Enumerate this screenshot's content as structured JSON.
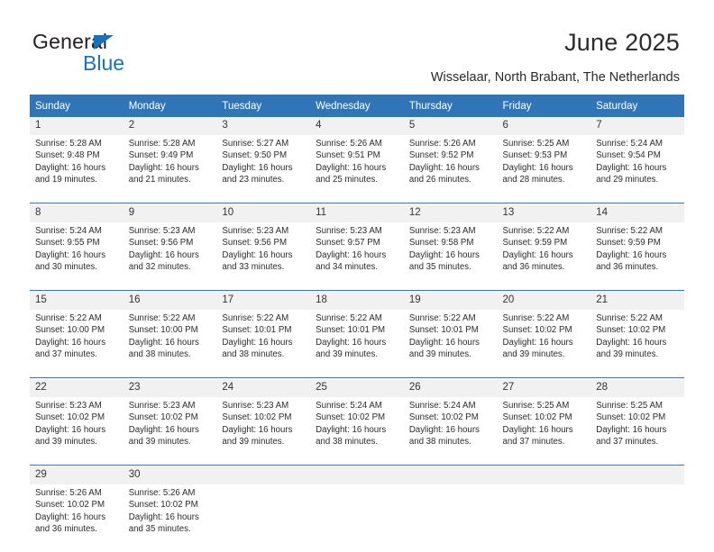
{
  "brand": {
    "name_top": "General",
    "name_bottom": "Blue",
    "triangle_icon": "triangle-icon",
    "accent_color": "#1a72b8"
  },
  "header": {
    "title": "June 2025",
    "subtitle": "Wisselaar, North Brabant, The Netherlands"
  },
  "theme": {
    "header_blue": "#3075b8",
    "daynum_background": "#f1f1f1",
    "text_color": "#2b2b2b"
  },
  "calendar": {
    "weekday_headers": [
      "Sunday",
      "Monday",
      "Tuesday",
      "Wednesday",
      "Thursday",
      "Friday",
      "Saturday"
    ],
    "weeks": [
      {
        "days": [
          {
            "num": "1",
            "sunrise": "Sunrise: 5:28 AM",
            "sunset": "Sunset: 9:48 PM",
            "daylight_1": "Daylight: 16 hours",
            "daylight_2": "and 19 minutes."
          },
          {
            "num": "2",
            "sunrise": "Sunrise: 5:28 AM",
            "sunset": "Sunset: 9:49 PM",
            "daylight_1": "Daylight: 16 hours",
            "daylight_2": "and 21 minutes."
          },
          {
            "num": "3",
            "sunrise": "Sunrise: 5:27 AM",
            "sunset": "Sunset: 9:50 PM",
            "daylight_1": "Daylight: 16 hours",
            "daylight_2": "and 23 minutes."
          },
          {
            "num": "4",
            "sunrise": "Sunrise: 5:26 AM",
            "sunset": "Sunset: 9:51 PM",
            "daylight_1": "Daylight: 16 hours",
            "daylight_2": "and 25 minutes."
          },
          {
            "num": "5",
            "sunrise": "Sunrise: 5:26 AM",
            "sunset": "Sunset: 9:52 PM",
            "daylight_1": "Daylight: 16 hours",
            "daylight_2": "and 26 minutes."
          },
          {
            "num": "6",
            "sunrise": "Sunrise: 5:25 AM",
            "sunset": "Sunset: 9:53 PM",
            "daylight_1": "Daylight: 16 hours",
            "daylight_2": "and 28 minutes."
          },
          {
            "num": "7",
            "sunrise": "Sunrise: 5:24 AM",
            "sunset": "Sunset: 9:54 PM",
            "daylight_1": "Daylight: 16 hours",
            "daylight_2": "and 29 minutes."
          }
        ]
      },
      {
        "days": [
          {
            "num": "8",
            "sunrise": "Sunrise: 5:24 AM",
            "sunset": "Sunset: 9:55 PM",
            "daylight_1": "Daylight: 16 hours",
            "daylight_2": "and 30 minutes."
          },
          {
            "num": "9",
            "sunrise": "Sunrise: 5:23 AM",
            "sunset": "Sunset: 9:56 PM",
            "daylight_1": "Daylight: 16 hours",
            "daylight_2": "and 32 minutes."
          },
          {
            "num": "10",
            "sunrise": "Sunrise: 5:23 AM",
            "sunset": "Sunset: 9:56 PM",
            "daylight_1": "Daylight: 16 hours",
            "daylight_2": "and 33 minutes."
          },
          {
            "num": "11",
            "sunrise": "Sunrise: 5:23 AM",
            "sunset": "Sunset: 9:57 PM",
            "daylight_1": "Daylight: 16 hours",
            "daylight_2": "and 34 minutes."
          },
          {
            "num": "12",
            "sunrise": "Sunrise: 5:23 AM",
            "sunset": "Sunset: 9:58 PM",
            "daylight_1": "Daylight: 16 hours",
            "daylight_2": "and 35 minutes."
          },
          {
            "num": "13",
            "sunrise": "Sunrise: 5:22 AM",
            "sunset": "Sunset: 9:59 PM",
            "daylight_1": "Daylight: 16 hours",
            "daylight_2": "and 36 minutes."
          },
          {
            "num": "14",
            "sunrise": "Sunrise: 5:22 AM",
            "sunset": "Sunset: 9:59 PM",
            "daylight_1": "Daylight: 16 hours",
            "daylight_2": "and 36 minutes."
          }
        ]
      },
      {
        "days": [
          {
            "num": "15",
            "sunrise": "Sunrise: 5:22 AM",
            "sunset": "Sunset: 10:00 PM",
            "daylight_1": "Daylight: 16 hours",
            "daylight_2": "and 37 minutes."
          },
          {
            "num": "16",
            "sunrise": "Sunrise: 5:22 AM",
            "sunset": "Sunset: 10:00 PM",
            "daylight_1": "Daylight: 16 hours",
            "daylight_2": "and 38 minutes."
          },
          {
            "num": "17",
            "sunrise": "Sunrise: 5:22 AM",
            "sunset": "Sunset: 10:01 PM",
            "daylight_1": "Daylight: 16 hours",
            "daylight_2": "and 38 minutes."
          },
          {
            "num": "18",
            "sunrise": "Sunrise: 5:22 AM",
            "sunset": "Sunset: 10:01 PM",
            "daylight_1": "Daylight: 16 hours",
            "daylight_2": "and 39 minutes."
          },
          {
            "num": "19",
            "sunrise": "Sunrise: 5:22 AM",
            "sunset": "Sunset: 10:01 PM",
            "daylight_1": "Daylight: 16 hours",
            "daylight_2": "and 39 minutes."
          },
          {
            "num": "20",
            "sunrise": "Sunrise: 5:22 AM",
            "sunset": "Sunset: 10:02 PM",
            "daylight_1": "Daylight: 16 hours",
            "daylight_2": "and 39 minutes."
          },
          {
            "num": "21",
            "sunrise": "Sunrise: 5:22 AM",
            "sunset": "Sunset: 10:02 PM",
            "daylight_1": "Daylight: 16 hours",
            "daylight_2": "and 39 minutes."
          }
        ]
      },
      {
        "days": [
          {
            "num": "22",
            "sunrise": "Sunrise: 5:23 AM",
            "sunset": "Sunset: 10:02 PM",
            "daylight_1": "Daylight: 16 hours",
            "daylight_2": "and 39 minutes."
          },
          {
            "num": "23",
            "sunrise": "Sunrise: 5:23 AM",
            "sunset": "Sunset: 10:02 PM",
            "daylight_1": "Daylight: 16 hours",
            "daylight_2": "and 39 minutes."
          },
          {
            "num": "24",
            "sunrise": "Sunrise: 5:23 AM",
            "sunset": "Sunset: 10:02 PM",
            "daylight_1": "Daylight: 16 hours",
            "daylight_2": "and 39 minutes."
          },
          {
            "num": "25",
            "sunrise": "Sunrise: 5:24 AM",
            "sunset": "Sunset: 10:02 PM",
            "daylight_1": "Daylight: 16 hours",
            "daylight_2": "and 38 minutes."
          },
          {
            "num": "26",
            "sunrise": "Sunrise: 5:24 AM",
            "sunset": "Sunset: 10:02 PM",
            "daylight_1": "Daylight: 16 hours",
            "daylight_2": "and 38 minutes."
          },
          {
            "num": "27",
            "sunrise": "Sunrise: 5:25 AM",
            "sunset": "Sunset: 10:02 PM",
            "daylight_1": "Daylight: 16 hours",
            "daylight_2": "and 37 minutes."
          },
          {
            "num": "28",
            "sunrise": "Sunrise: 5:25 AM",
            "sunset": "Sunset: 10:02 PM",
            "daylight_1": "Daylight: 16 hours",
            "daylight_2": "and 37 minutes."
          }
        ]
      },
      {
        "days": [
          {
            "num": "29",
            "sunrise": "Sunrise: 5:26 AM",
            "sunset": "Sunset: 10:02 PM",
            "daylight_1": "Daylight: 16 hours",
            "daylight_2": "and 36 minutes."
          },
          {
            "num": "30",
            "sunrise": "Sunrise: 5:26 AM",
            "sunset": "Sunset: 10:02 PM",
            "daylight_1": "Daylight: 16 hours",
            "daylight_2": "and 35 minutes."
          },
          {
            "num": "",
            "sunrise": "",
            "sunset": "",
            "daylight_1": "",
            "daylight_2": ""
          },
          {
            "num": "",
            "sunrise": "",
            "sunset": "",
            "daylight_1": "",
            "daylight_2": ""
          },
          {
            "num": "",
            "sunrise": "",
            "sunset": "",
            "daylight_1": "",
            "daylight_2": ""
          },
          {
            "num": "",
            "sunrise": "",
            "sunset": "",
            "daylight_1": "",
            "daylight_2": ""
          },
          {
            "num": "",
            "sunrise": "",
            "sunset": "",
            "daylight_1": "",
            "daylight_2": ""
          }
        ]
      }
    ]
  }
}
